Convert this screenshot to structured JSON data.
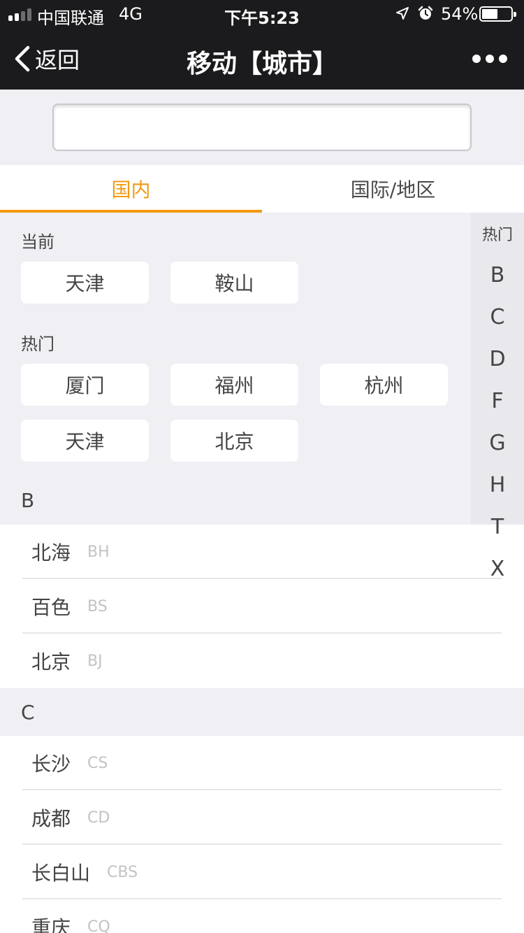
{
  "status_bar": {
    "carrier": "中国联通",
    "network": "4G",
    "time": "下午5:23",
    "battery_percent": "54%",
    "battery_level": 0.54,
    "signal_bars_filled": 2,
    "signal_bars_total": 4,
    "icons": [
      "location-arrow-icon",
      "alarm-clock-icon"
    ]
  },
  "nav": {
    "back_label": "返回",
    "title": "移动【城市】",
    "more_icon": "ellipsis-icon"
  },
  "search": {
    "value": "",
    "placeholder": ""
  },
  "tabs": [
    {
      "label": "国内",
      "active": true
    },
    {
      "label": "国际/地区",
      "active": false
    }
  ],
  "current": {
    "label": "当前",
    "cities": [
      "天津",
      "鞍山"
    ]
  },
  "hot": {
    "label": "热门",
    "cities": [
      "厦门",
      "福州",
      "杭州",
      "天津",
      "北京"
    ]
  },
  "groups": [
    {
      "letter": "B",
      "cities": [
        {
          "name": "北海",
          "abbr": "BH"
        },
        {
          "name": "百色",
          "abbr": "BS"
        },
        {
          "name": "北京",
          "abbr": "BJ"
        }
      ]
    },
    {
      "letter": "C",
      "cities": [
        {
          "name": "长沙",
          "abbr": "CS"
        },
        {
          "name": "成都",
          "abbr": "CD"
        },
        {
          "name": "长白山",
          "abbr": "CBS"
        },
        {
          "name": "重庆",
          "abbr": "CQ"
        }
      ]
    }
  ],
  "index": [
    "热门",
    "B",
    "C",
    "D",
    "F",
    "G",
    "H",
    "T",
    "X"
  ],
  "colors": {
    "accent": "#f29a13",
    "bar_bg": "#1b1b1d",
    "page_bg": "#efeff4"
  }
}
